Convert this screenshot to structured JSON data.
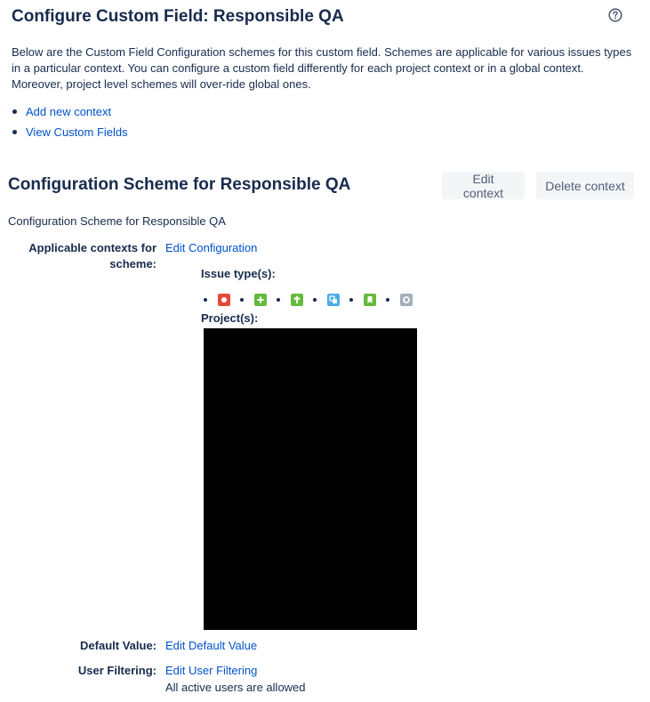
{
  "header": {
    "title": "Configure Custom Field: Responsible QA",
    "help_icon": "question-circle-icon"
  },
  "intro": {
    "text": "Below are the Custom Field Configuration schemes for this custom field. Schemes are applicable for various issues types in a particular context. You can configure a custom field differently for each project context or in a global context. Moreover, project level schemes will over-ride global ones."
  },
  "links": [
    {
      "label": "Add new context"
    },
    {
      "label": "View Custom Fields"
    }
  ],
  "scheme": {
    "title": "Configuration Scheme for Responsible QA",
    "edit_context_label": "Edit context",
    "delete_context_label": "Delete context",
    "description": "Configuration Scheme for Responsible QA",
    "contexts_label": "Applicable contexts for scheme:",
    "edit_configuration_label": "Edit Configuration",
    "issue_types_label": "Issue type(s):",
    "issue_types": [
      {
        "icon": "bug-icon",
        "color": "#e5493a"
      },
      {
        "icon": "new-feature-icon",
        "color": "#63ba3c"
      },
      {
        "icon": "improvement-icon",
        "color": "#63ba3c"
      },
      {
        "icon": "task-icon",
        "color": "#4bade8"
      },
      {
        "icon": "story-icon",
        "color": "#63ba3c"
      },
      {
        "icon": "sub-task-icon",
        "color": "#a5adba"
      }
    ],
    "projects_label": "Project(s):",
    "default_value_label": "Default Value:",
    "edit_default_value_label": "Edit Default Value",
    "user_filtering_label": "User Filtering:",
    "edit_user_filtering_label": "Edit User Filtering",
    "user_filtering_note": "All active users are allowed"
  },
  "colors": {
    "link": "#0052cc",
    "text": "#172b4d",
    "button_bg": "#f4f5f7",
    "button_text": "#505f79",
    "redacted": "#000000"
  }
}
